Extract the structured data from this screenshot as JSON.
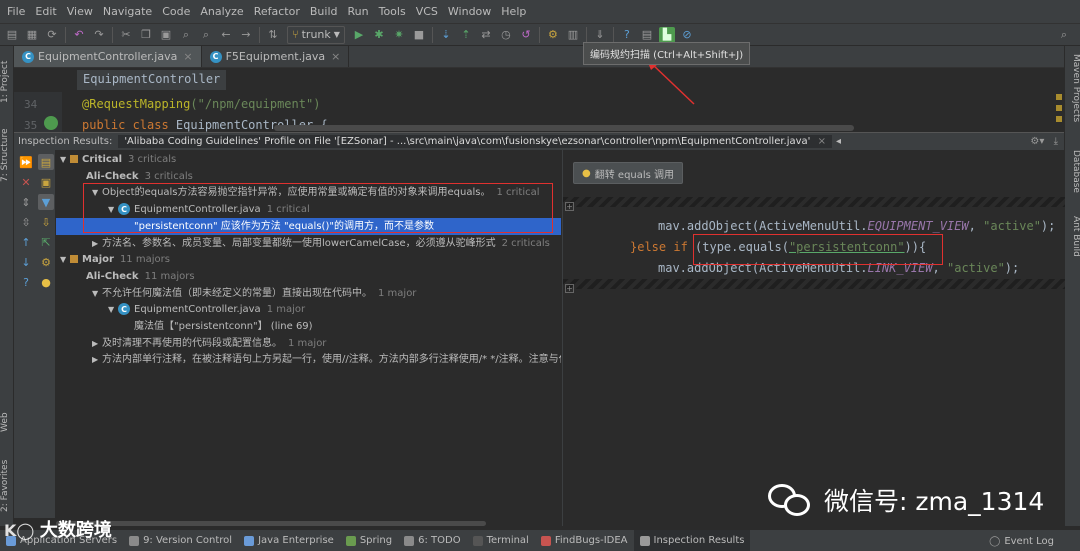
{
  "menu": [
    "File",
    "Edit",
    "View",
    "Navigate",
    "Code",
    "Analyze",
    "Refactor",
    "Build",
    "Run",
    "Tools",
    "VCS",
    "Window",
    "Help"
  ],
  "toolbar": {
    "vcs_branch": "trunk"
  },
  "tooltip": "编码规约扫描 (Ctrl+Alt+Shift+J)",
  "left_tool_tabs": {
    "project": "1: Project",
    "structure": "7: Structure",
    "web": "Web",
    "favorites": "2: Favorites"
  },
  "right_tool_tabs": {
    "maven": "Maven Projects",
    "database": "Database",
    "ant": "Ant Build"
  },
  "editor_tabs": [
    {
      "label": "EquipmentController.java",
      "active": true
    },
    {
      "label": "F5Equipment.java",
      "active": false
    }
  ],
  "breadcrumb": "EquipmentController",
  "code_top": [
    {
      "line": "34",
      "text_a": "@RequestMapping",
      "text_b": "(\"/npm/equipment\")"
    },
    {
      "line": "35",
      "text_a": "public class ",
      "text_b": "EquipmentController {"
    }
  ],
  "inspection": {
    "label": "Inspection Results:",
    "title": "'Alibaba Coding Guidelines' Profile on File '[EZSonar] - ...\\src\\main\\java\\com\\fusionskye\\ezsonar\\controller\\npm\\EquipmentController.java'",
    "tree": [
      {
        "indent": 0,
        "arrow": "▼",
        "label": "Critical",
        "count": "3 criticals",
        "bold": true,
        "icon": true
      },
      {
        "indent": 1,
        "arrow": "",
        "label": "Ali-Check",
        "count": "3 criticals",
        "bold": true
      },
      {
        "indent": 2,
        "arrow": "▼",
        "label": "Object的equals方法容易抛空指针异常，应使用常量或确定有值的对象来调用equals。",
        "count": "1 critical"
      },
      {
        "indent": 3,
        "arrow": "▼",
        "label": "EquipmentController.java",
        "count": "1 critical",
        "file": true
      },
      {
        "indent": 4,
        "arrow": "",
        "label": "\"persistentconn\" 应该作为方法 \"equals()\"的调用方，而不是参数",
        "count": "",
        "selected": true
      },
      {
        "indent": 2,
        "arrow": "▶",
        "label": "方法名、参数名、成员变量、局部变量都统一使用lowerCamelCase，必须遵从驼峰形式",
        "count": "2 criticals"
      },
      {
        "indent": 0,
        "arrow": "▼",
        "label": "Major",
        "count": "11 majors",
        "bold": true,
        "icon": true
      },
      {
        "indent": 1,
        "arrow": "",
        "label": "Ali-Check",
        "count": "11 majors",
        "bold": true
      },
      {
        "indent": 2,
        "arrow": "▼",
        "label": "不允许任何魔法值（即未经定义的常量）直接出现在代码中。",
        "count": "1 major"
      },
      {
        "indent": 3,
        "arrow": "▼",
        "label": "EquipmentController.java",
        "count": "1 major",
        "file": true
      },
      {
        "indent": 4,
        "arrow": "",
        "label": "魔法值【\"persistentconn\"】 (line 69)",
        "count": ""
      },
      {
        "indent": 2,
        "arrow": "▶",
        "label": "及时清理不再使用的代码段或配置信息。",
        "count": "1 major"
      },
      {
        "indent": 2,
        "arrow": "▶",
        "label": "方法内部单行注释，在被注释语句上方另起一行，使用//注释。方法内部多行注释使用/* */注释。注意与代码",
        "count": ""
      }
    ]
  },
  "fix_button": "翻转 equals 调用",
  "preview_code": {
    "l1_a": "mav.addObject(ActiveMenuUtil.",
    "l1_b": "EQUIPMENT_VIEW",
    "l1_c": ", ",
    "l1_d": "\"active\"",
    "l1_e": ");",
    "l2_a": "}else if ",
    "l2_b": "(type.equals(",
    "l2_c": "\"persistentconn\"",
    "l2_d": ")){",
    "l3_a": "mav.addObject(ActiveMenuUtil.",
    "l3_b": "LINK_VIEW",
    "l3_c": ", ",
    "l3_d": "\"active\"",
    "l3_e": ");"
  },
  "watermark": "微信号: zma_1314",
  "logo": "大数跨境",
  "status_tabs": [
    {
      "label": "Application Servers",
      "color": "#6a9bd8"
    },
    {
      "label": "9: Version Control",
      "color": "#8a8a8a"
    },
    {
      "label": "Java Enterprise",
      "color": "#6a9bd8"
    },
    {
      "label": "Spring",
      "color": "#6a9b4f"
    },
    {
      "label": "6: TODO",
      "color": "#8a8a8a"
    },
    {
      "label": "Terminal",
      "color": "#555555"
    },
    {
      "label": "FindBugs-IDEA",
      "color": "#c75450"
    },
    {
      "label": "Inspection Results",
      "color": "#9a9a9a",
      "active": true
    }
  ],
  "event_log": "Event Log"
}
